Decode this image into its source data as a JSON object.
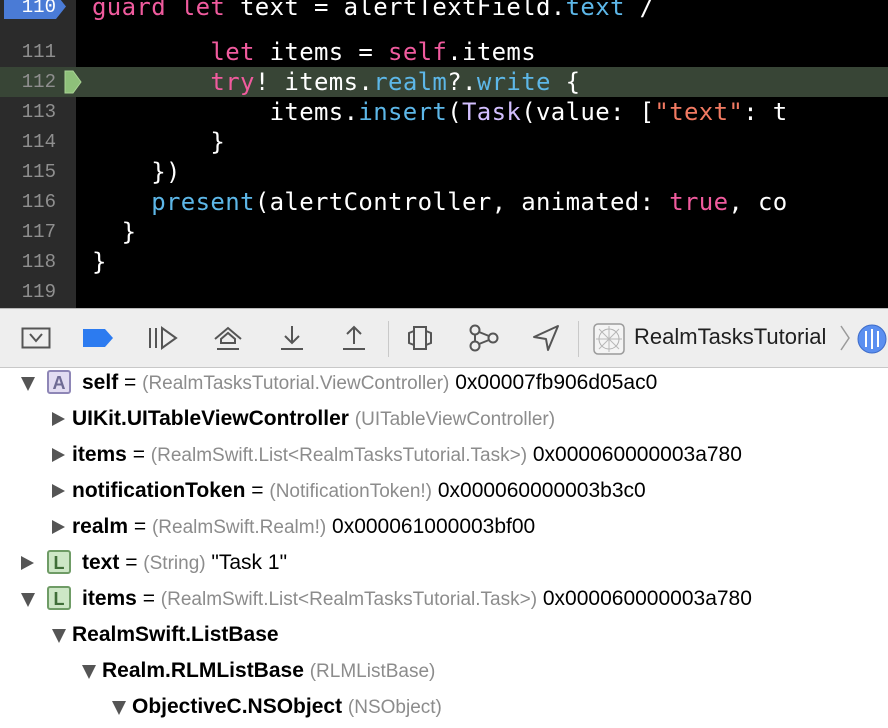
{
  "editor": {
    "lines": [
      {
        "num": "110",
        "code": [
          {
            "t": "guard ",
            "c": "kw"
          },
          {
            "t": "let ",
            "c": "kw"
          },
          {
            "t": "text = alertTextField."
          },
          {
            "t": "text",
            "c": "fn"
          },
          {
            "t": " /"
          }
        ]
      },
      {
        "num": "111",
        "code": [
          {
            "t": "        "
          },
          {
            "t": "let",
            "c": "kw"
          },
          {
            "t": " items = "
          },
          {
            "t": "self",
            "c": "kw"
          },
          {
            "t": ".items"
          }
        ]
      },
      {
        "num": "112",
        "code": [
          {
            "t": "        "
          },
          {
            "t": "try",
            "c": "kw"
          },
          {
            "t": "! items."
          },
          {
            "t": "realm",
            "c": "fn"
          },
          {
            "t": "?."
          },
          {
            "t": "write",
            "c": "fn"
          },
          {
            "t": " {"
          }
        ]
      },
      {
        "num": "113",
        "code": [
          {
            "t": "            items."
          },
          {
            "t": "insert",
            "c": "fn"
          },
          {
            "t": "("
          },
          {
            "t": "Task",
            "c": "ty"
          },
          {
            "t": "(value: ["
          },
          {
            "t": "\"text\"",
            "c": "str"
          },
          {
            "t": ": t"
          }
        ]
      },
      {
        "num": "114",
        "code": [
          {
            "t": "        }"
          }
        ]
      },
      {
        "num": "115",
        "code": [
          {
            "t": "    })"
          }
        ]
      },
      {
        "num": "116",
        "code": [
          {
            "t": "    "
          },
          {
            "t": "present",
            "c": "fn"
          },
          {
            "t": "(alertController, animated: "
          },
          {
            "t": "true",
            "c": "kw"
          },
          {
            "t": ", co"
          }
        ]
      },
      {
        "num": "117",
        "code": [
          {
            "t": "  }"
          }
        ]
      },
      {
        "num": "118",
        "code": [
          {
            "t": "}"
          }
        ]
      },
      {
        "num": "119",
        "code": []
      }
    ],
    "breakpoint_line": "110",
    "current_line": "112"
  },
  "debug_bar": {
    "target_name": "RealmTasksTutorial"
  },
  "variables": [
    {
      "badge": "A",
      "expanded": true,
      "name": "self",
      "eq": " = ",
      "type": "(RealmTasksTutorial.ViewController)",
      "value": " 0x00007fb906d05ac0"
    },
    {
      "badge": "",
      "expanded": false,
      "name": "UIKit.UITableViewController",
      "eq": " ",
      "type": "(UITableViewController)",
      "value": ""
    },
    {
      "badge": "",
      "expanded": false,
      "name": "items",
      "eq": " = ",
      "type": "(RealmSwift.List<RealmTasksTutorial.Task>)",
      "value": " 0x000060000003a780"
    },
    {
      "badge": "",
      "expanded": false,
      "name": "notificationToken",
      "eq": " = ",
      "type": "(NotificationToken!)",
      "value": " 0x000060000003b3c0"
    },
    {
      "badge": "",
      "expanded": false,
      "name": "realm",
      "eq": " = ",
      "type": "(RealmSwift.Realm!)",
      "value": " 0x000061000003bf00"
    },
    {
      "badge": "L",
      "expanded": false,
      "name": "text",
      "eq": " = ",
      "type": "(String)",
      "value": " \"Task 1\""
    },
    {
      "badge": "L",
      "expanded": true,
      "name": "items",
      "eq": " = ",
      "type": "(RealmSwift.List<RealmTasksTutorial.Task>)",
      "value": " 0x000060000003a780"
    },
    {
      "badge": "",
      "expanded": true,
      "name": "RealmSwift.ListBase",
      "eq": "",
      "type": "",
      "value": ""
    },
    {
      "badge": "",
      "expanded": true,
      "name": "Realm.RLMListBase",
      "eq": " ",
      "type": "(RLMListBase)",
      "value": ""
    },
    {
      "badge": "",
      "expanded": true,
      "name": "ObjectiveC.NSObject",
      "eq": " ",
      "type": "(NSObject)",
      "value": ""
    }
  ],
  "colors": {
    "keyword": "#f05b9e",
    "function": "#5db7e8",
    "type": "#d3bfff",
    "string": "#f27a62",
    "breakpoint": "#4a7bd6",
    "current_line": "#384536"
  },
  "icons": [
    "hide-debug-area-icon",
    "breakpoints-toggle-icon",
    "continue-icon",
    "step-over-icon",
    "step-into-icon",
    "step-out-icon",
    "view-hierarchy-icon",
    "memory-graph-icon",
    "location-icon",
    "app-target-icon",
    "chevron-right-icon",
    "thread-icon"
  ]
}
